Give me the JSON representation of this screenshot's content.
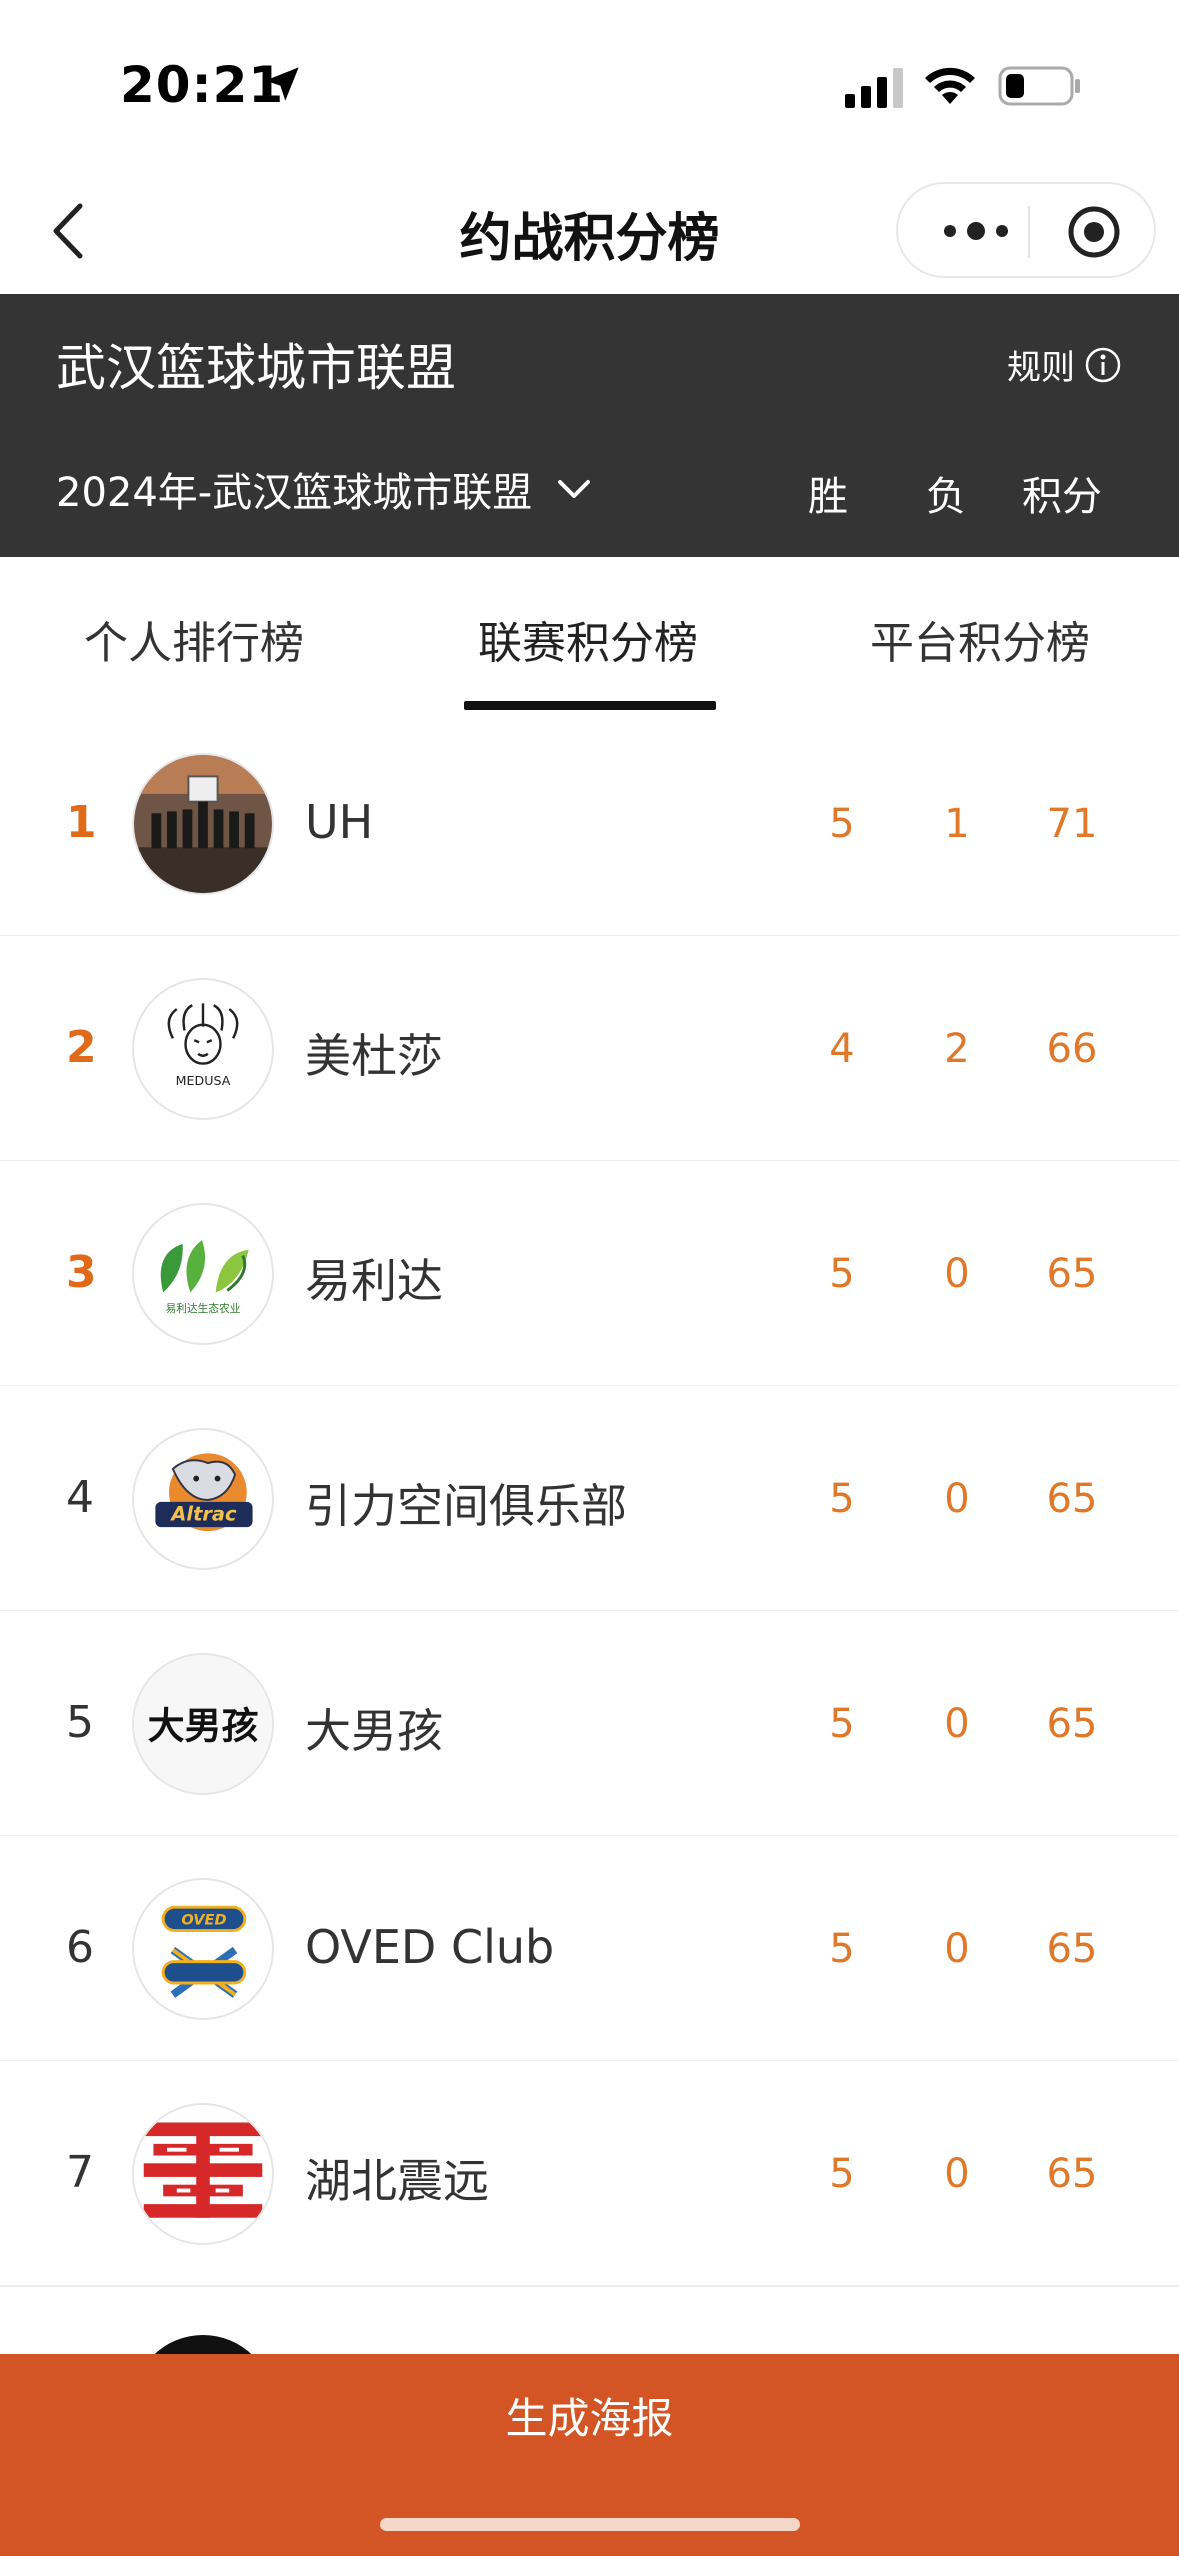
{
  "status_bar": {
    "time": "20:21"
  },
  "nav": {
    "title": "约战积分榜"
  },
  "header": {
    "league_name": "武汉篮球城市联盟",
    "rules_label": "规则",
    "season_label": "2024年-武汉篮球城市联盟",
    "col_win": "胜",
    "col_loss": "负",
    "col_points": "积分"
  },
  "tabs": [
    {
      "label": "个人排行榜"
    },
    {
      "label": "联赛积分榜",
      "active": true
    },
    {
      "label": "平台积分榜"
    }
  ],
  "teams": [
    {
      "rank": "1",
      "name": "UH",
      "wins": "5",
      "losses": "1",
      "points": "71"
    },
    {
      "rank": "2",
      "name": "美杜莎",
      "wins": "4",
      "losses": "2",
      "points": "66",
      "logo_text": "MEDUSA"
    },
    {
      "rank": "3",
      "name": "易利达",
      "wins": "5",
      "losses": "0",
      "points": "65",
      "logo_text": "易利达生态农业"
    },
    {
      "rank": "4",
      "name": "引力空间俱乐部",
      "wins": "5",
      "losses": "0",
      "points": "65",
      "logo_text": "Altrac"
    },
    {
      "rank": "5",
      "name": "大男孩",
      "wins": "5",
      "losses": "0",
      "points": "65",
      "logo_text": "大男孩"
    },
    {
      "rank": "6",
      "name": "OVED Club",
      "wins": "5",
      "losses": "0",
      "points": "65",
      "logo_text": "OVED"
    },
    {
      "rank": "7",
      "name": "湖北震远",
      "wins": "5",
      "losses": "0",
      "points": "65"
    }
  ],
  "footer": {
    "button_label": "生成海报"
  },
  "colors": {
    "accent": "#e0782a",
    "header_bg": "#343434",
    "footer_bg": "#d35526"
  }
}
